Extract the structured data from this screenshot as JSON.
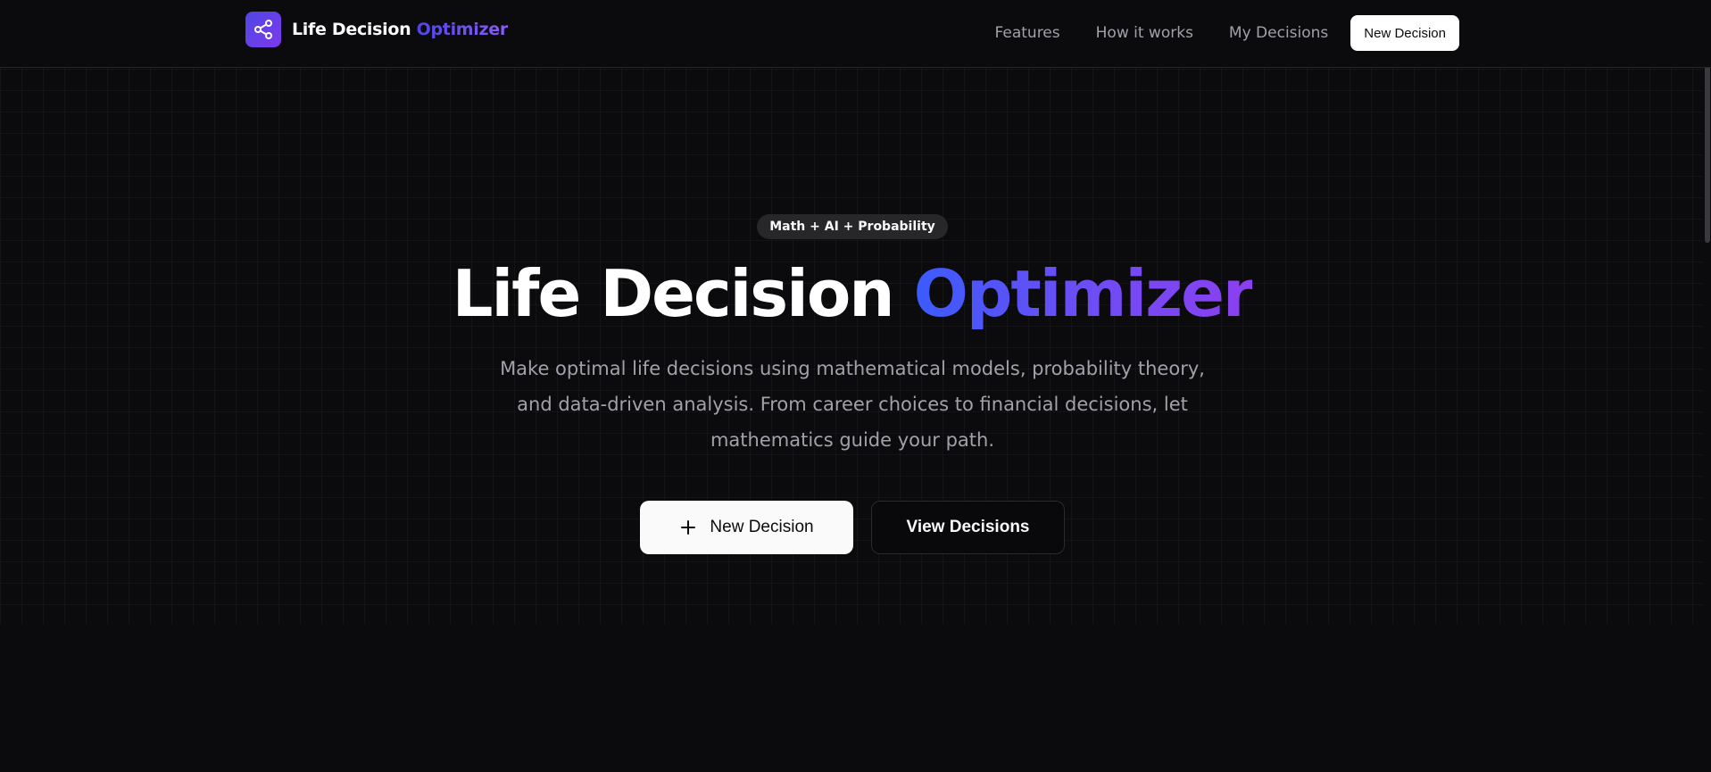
{
  "brand": {
    "name": "Life Decision",
    "name_accent": "Optimizer",
    "logo_icon": "share-nodes-icon",
    "accent_color": "#6366f1"
  },
  "nav": {
    "links": [
      "Features",
      "How it works",
      "My Decisions"
    ],
    "cta_label": "New Decision"
  },
  "hero": {
    "badge": "Math + AI + Probability",
    "title": "Life Decision",
    "title_accent": "Optimizer",
    "subtitle": "Make optimal life decisions using mathematical models, probability theory, and data-driven analysis. From career choices to financial decisions, let mathematics guide your path.",
    "primary_button": "New Decision",
    "primary_icon": "plus-icon",
    "secondary_button": "View Decisions"
  },
  "colors": {
    "background": "#0b0b0d",
    "gradient_start": "#3b5bfd",
    "gradient_end": "#8b3ff0"
  }
}
